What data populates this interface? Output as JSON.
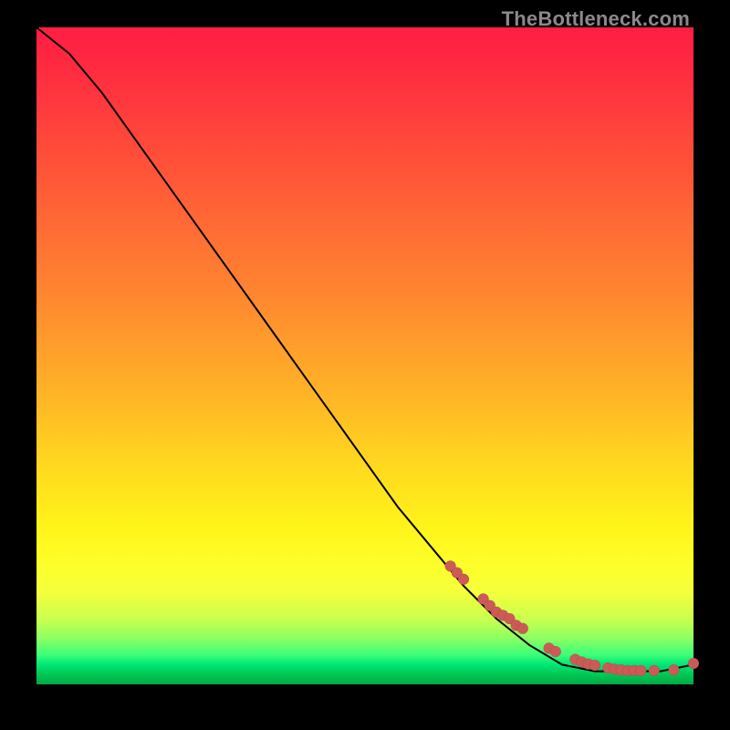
{
  "watermark": "TheBottleneck.com",
  "colors": {
    "point": "#cc5a57",
    "curve": "#000000",
    "frame_bg": "#000000"
  },
  "chart_data": {
    "type": "line",
    "title": "",
    "xlabel": "",
    "ylabel": "",
    "xlim": [
      0,
      100
    ],
    "ylim": [
      0,
      100
    ],
    "grid": false,
    "legend": false,
    "series": [
      {
        "name": "curve",
        "style": "line",
        "x": [
          0,
          5,
          10,
          15,
          20,
          25,
          30,
          35,
          40,
          45,
          50,
          55,
          60,
          65,
          70,
          75,
          80,
          85,
          90,
          95,
          100
        ],
        "y": [
          100,
          96,
          90,
          83,
          76,
          69,
          62,
          55,
          48,
          41,
          34,
          27,
          21,
          15,
          10,
          6,
          3,
          2,
          2,
          2,
          3
        ]
      },
      {
        "name": "highlighted-points",
        "style": "scatter",
        "x": [
          63,
          64,
          65,
          68,
          69,
          70,
          71,
          72,
          73,
          74,
          78,
          79,
          82,
          83,
          84,
          85,
          87,
          88,
          89,
          90,
          91,
          92,
          94,
          97,
          100
        ],
        "y": [
          18,
          17,
          16,
          13,
          12,
          11,
          10.5,
          10,
          9,
          8.5,
          5.5,
          5,
          3.8,
          3.4,
          3.1,
          2.9,
          2.5,
          2.3,
          2.2,
          2.1,
          2.1,
          2.1,
          2.1,
          2.2,
          3.2
        ]
      }
    ]
  }
}
